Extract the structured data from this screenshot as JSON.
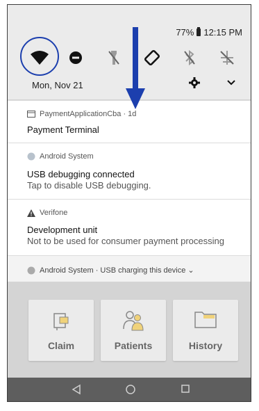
{
  "status_bar": {
    "battery": "77%",
    "time": "12:15 PM"
  },
  "quick_settings": {
    "date": "Mon, Nov 21",
    "tiles": [
      "wifi-icon",
      "do-not-disturb-icon",
      "flashlight-off-icon",
      "auto-rotate-icon",
      "bluetooth-off-icon",
      "airplane-mode-off-icon"
    ]
  },
  "notifications": [
    {
      "app": "PaymentApplicationCba · 1d",
      "title": "Payment Terminal",
      "icon": "window-icon"
    },
    {
      "app": "Android System",
      "title": "USB debugging connected",
      "text": "Tap to disable USB debugging.",
      "icon": "android-system-icon"
    },
    {
      "app": "Verifone",
      "title": "Development unit",
      "text": "Not to be used for consumer payment processing",
      "icon": "warning-icon"
    },
    {
      "app": "Android System · USB charging this device ⌄",
      "icon": "android-system-icon"
    }
  ],
  "app_tiles": [
    {
      "label": "Claim",
      "icon": "claim-icon"
    },
    {
      "label": "Patients",
      "icon": "patients-icon"
    },
    {
      "label": "History",
      "icon": "folder-icon"
    }
  ],
  "nav": [
    "back-icon",
    "home-icon",
    "recents-icon"
  ],
  "colors": {
    "annotation": "#1c3fae",
    "panel": "#ebebeb",
    "navbar": "#5e5e5e"
  }
}
